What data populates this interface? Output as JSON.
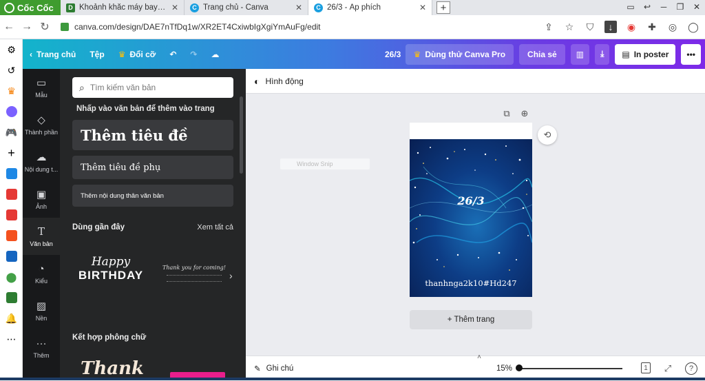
{
  "browser": {
    "brand": "Cốc Cốc",
    "tabs": [
      {
        "title": "Khoảnh khắc máy bay Trung",
        "icon_letter": "D",
        "color": "#2e7d32",
        "active": false
      },
      {
        "title": "Trang chủ - Canva",
        "icon_letter": "C",
        "color": "#1a9fe0",
        "active": false
      },
      {
        "title": "26/3 - Áp phích",
        "icon_letter": "C",
        "color": "#1a9fe0",
        "active": true
      }
    ],
    "url": "canva.com/design/DAE7nTfDq1w/XR2ET4CxiwbIgXgiYmAuFg/edit"
  },
  "header": {
    "home": "Trang chủ",
    "file": "Tệp",
    "resize": "Đổi cỡ",
    "doc_title": "26/3",
    "try_pro": "Dùng thử Canva Pro",
    "share": "Chia sẻ",
    "print": "In poster"
  },
  "rail": [
    {
      "name": "mau",
      "label": "Mẫu",
      "glyph": "▭"
    },
    {
      "name": "thanh-phan",
      "label": "Thành phần",
      "glyph": "◇△"
    },
    {
      "name": "noi-dung",
      "label": "Nội dung t...",
      "glyph": "☁"
    },
    {
      "name": "anh",
      "label": "Ảnh",
      "glyph": "▣"
    },
    {
      "name": "van-ban",
      "label": "Văn bản",
      "glyph": "T"
    },
    {
      "name": "kieu",
      "label": "Kiểu",
      "glyph": "◔"
    },
    {
      "name": "nen",
      "label": "Nền",
      "glyph": "▨"
    },
    {
      "name": "them",
      "label": "Thêm",
      "glyph": "···"
    }
  ],
  "panel": {
    "search_placeholder": "Tìm kiếm văn bản",
    "hint": "Nhấp vào văn bản để thêm vào trang",
    "heading": "Thêm tiêu đề",
    "subheading": "Thêm tiêu đề phụ",
    "body": "Thêm nội dung thân văn bản",
    "recent": "Dùng gần đây",
    "see_all": "Xem tất cả",
    "recent_items": [
      "Happy",
      "BIRTHDAY",
      "Thank you for coming!"
    ],
    "combos": "Kết hợp phông chữ",
    "combo_preview": "Thank"
  },
  "editor": {
    "animate": "Hình động",
    "poster_title": "26/3",
    "poster_user": "thanhnga2k10#Hd247",
    "add_page": "+ Thêm trang",
    "notes": "Ghi chú",
    "zoom": "15%",
    "page_count": "1",
    "snip": "Window Snip"
  },
  "icons": {
    "search": "search-icon",
    "undo": "undo-icon",
    "redo": "redo-icon",
    "cloud": "cloud-icon"
  }
}
